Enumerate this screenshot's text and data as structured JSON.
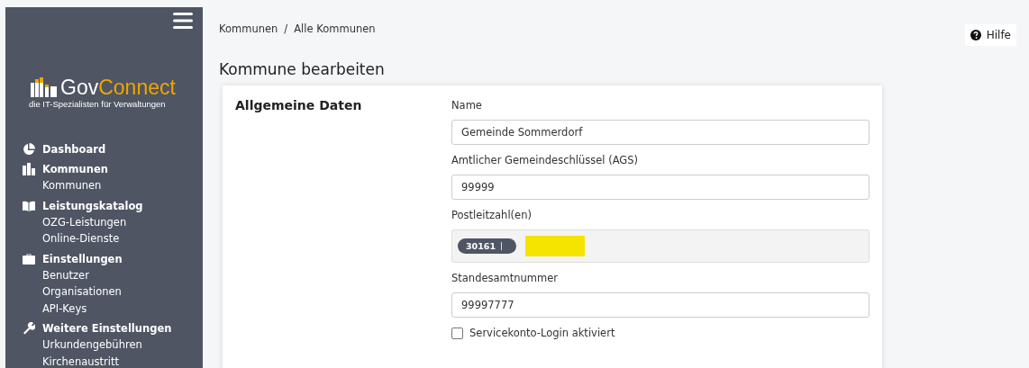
{
  "sidebar": {
    "logo": {
      "part1": "Gov",
      "part2": "Connect",
      "tagline": "die IT-Spezialisten für Verwaltungen"
    },
    "groups": [
      {
        "label": "Dashboard"
      },
      {
        "label": "Kommunen",
        "items": [
          "Kommunen"
        ]
      },
      {
        "label": "Leistungskatalog",
        "items": [
          "OZG-Leistungen",
          "Online-Dienste"
        ]
      },
      {
        "label": "Einstellungen",
        "items": [
          "Benutzer",
          "Organisationen",
          "API-Keys"
        ]
      },
      {
        "label": "Weitere Einstellungen",
        "items": [
          "Urkundengebühren",
          "Kirchenaustritt"
        ]
      }
    ]
  },
  "breadcrumb": [
    "Kommunen",
    "/",
    "Alle Kommunen"
  ],
  "help": "Hilfe",
  "title": "Kommune bearbeiten",
  "section": "Allgemeine Daten",
  "fields": [
    {
      "kind": "text",
      "label": "Name",
      "value": "Gemeinde Sommerdorf"
    },
    {
      "kind": "text",
      "label": "Amtlicher Gemeindeschlüssel (AGS)",
      "value": "99999"
    },
    {
      "kind": "tags",
      "label": "Postleitzahl(en)",
      "tags": [
        "30161"
      ]
    },
    {
      "kind": "text",
      "label": "Standesamtnummer",
      "value": "99997777"
    },
    {
      "kind": "checkbox",
      "label": "Servicekonto-Login aktiviert",
      "checked": false
    }
  ]
}
